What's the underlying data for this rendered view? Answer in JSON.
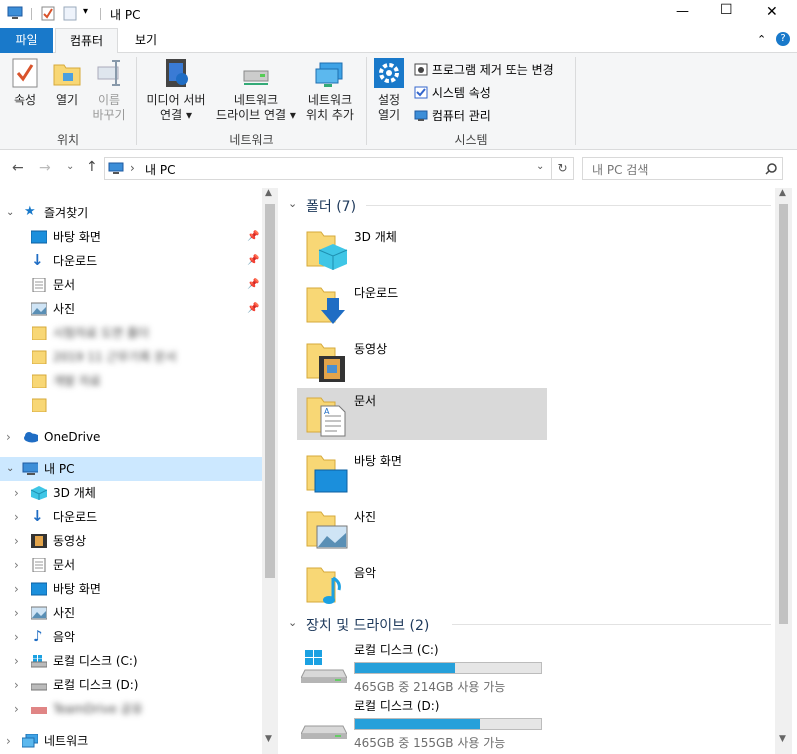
{
  "window": {
    "title": "내 PC",
    "minimize": "—",
    "maximize": "☐",
    "close": "✕"
  },
  "ribbon_tabs": {
    "file": "파일",
    "computer": "컴퓨터",
    "view": "보기",
    "help": "?"
  },
  "ribbon": {
    "properties": "속성",
    "open": "열기",
    "rename_line1": "이름",
    "rename_line2": "바꾸기",
    "group_location": "위치",
    "media_line1": "미디어 서버",
    "media_line2": "연결",
    "map_drive_line1": "네트워크",
    "map_drive_line2": "드라이브 연결",
    "add_location_line1": "네트워크",
    "add_location_line2": "위치 추가",
    "group_network": "네트워크",
    "settings_line1": "설정",
    "settings_line2": "열기",
    "uninstall": "프로그램 제거 또는 변경",
    "system_props": "시스템 속성",
    "manage": "컴퓨터 관리",
    "group_system": "시스템"
  },
  "address": {
    "path": "내 PC",
    "search_placeholder": "내 PC 검색"
  },
  "nav": {
    "quick_access": "즐겨찾기",
    "qa_items": [
      {
        "label": "바탕 화면"
      },
      {
        "label": "다운로드"
      },
      {
        "label": "문서"
      },
      {
        "label": "사진"
      }
    ],
    "blurred": [
      "시험자료 도면 폴더",
      "2019 11 근무기록 문서",
      "개발 자료"
    ],
    "onedrive": "OneDrive",
    "this_pc": "내 PC",
    "pc_items": [
      {
        "label": "3D 개체"
      },
      {
        "label": "다운로드"
      },
      {
        "label": "동영상"
      },
      {
        "label": "문서"
      },
      {
        "label": "바탕 화면"
      },
      {
        "label": "사진"
      },
      {
        "label": "음악"
      },
      {
        "label": "로컬 디스크 (C:)"
      },
      {
        "label": "로컬 디스크 (D:)"
      }
    ],
    "blurred_drive": "TeamDrive 공유",
    "network": "네트워크"
  },
  "content": {
    "folders_header": "폴더 (7)",
    "folders": [
      {
        "label": "3D 개체"
      },
      {
        "label": "다운로드"
      },
      {
        "label": "동영상"
      },
      {
        "label": "문서"
      },
      {
        "label": "바탕 화면"
      },
      {
        "label": "사진"
      },
      {
        "label": "음악"
      }
    ],
    "drives_header": "장치 및 드라이브 (2)",
    "drives": [
      {
        "label": "로컬 디스크 (C:)",
        "info": "465GB 중 214GB 사용 가능",
        "used_fraction": 0.54
      },
      {
        "label": "로컬 디스크 (D:)",
        "info": "465GB 중 155GB 사용 가능",
        "used_fraction": 0.67
      }
    ]
  },
  "colors": {
    "accent": "#1979ca",
    "selection": "#cce8ff",
    "folder": "#f8d775",
    "bar": "#26a0da"
  }
}
